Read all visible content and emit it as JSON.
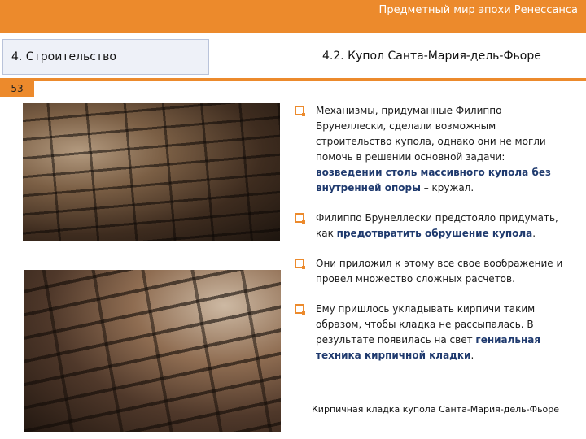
{
  "header": {
    "deck_title": "Предметный мир эпохи Ренессанса"
  },
  "section": {
    "label": "4. Строительство"
  },
  "subtitle": "4.2. Купол Санта-Мария-дель-Фьоре",
  "page_number": "53",
  "bullets": [
    {
      "parts": [
        "Механизмы, придуманные Филиппо Брунеллески, сделали возможным строительство купола, однако они не могли помочь в решении основной задачи: ",
        "возведении столь массивного купола без внутренней опоры",
        " – кружал."
      ]
    },
    {
      "parts": [
        "Филиппо Брунеллески предстояло придумать, как ",
        "предотвратить обрушение купола",
        "."
      ]
    },
    {
      "parts": [
        "Они приложил к этому все свое воображение и провел множество сложных расчетов."
      ]
    },
    {
      "parts": [
        "Ему пришлось укладывать кирпичи таким образом, чтобы кладка не рассыпалась. В результате появилась на свет ",
        "гениальная техника кирпичной кладки",
        "."
      ]
    }
  ],
  "caption": "Кирпичная кладка купола Санта-Мария-дель-Фьоре",
  "colors": {
    "accent": "#ec8a2c",
    "highlight": "#1f3a6e",
    "section_box": "#eef1f8"
  },
  "icons": {
    "bullet": "checkbox-square-icon"
  }
}
